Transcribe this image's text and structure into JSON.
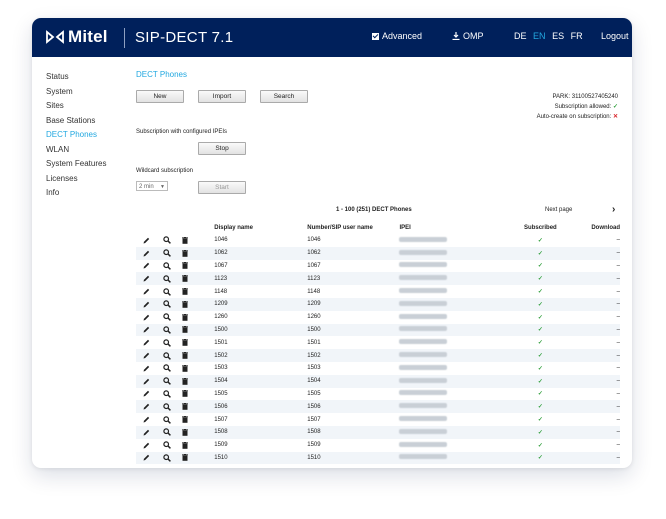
{
  "header": {
    "logo_text": "Mitel",
    "app_title": "SIP-DECT 7.1",
    "advanced_label": "Advanced",
    "omp_label": "OMP",
    "languages": [
      {
        "code": "DE",
        "active": false
      },
      {
        "code": "EN",
        "active": true
      },
      {
        "code": "ES",
        "active": false
      },
      {
        "code": "FR",
        "active": false
      }
    ],
    "logout_label": "Logout"
  },
  "sidebar": {
    "items": [
      {
        "label": "Status",
        "active": false
      },
      {
        "label": "System",
        "active": false
      },
      {
        "label": "Sites",
        "active": false
      },
      {
        "label": "Base Stations",
        "active": false
      },
      {
        "label": "DECT Phones",
        "active": true
      },
      {
        "label": "WLAN",
        "active": false
      },
      {
        "label": "System Features",
        "active": false
      },
      {
        "label": "Licenses",
        "active": false
      },
      {
        "label": "Info",
        "active": false
      }
    ]
  },
  "main": {
    "page_title": "DECT Phones",
    "new_label": "New",
    "import_label": "Import",
    "search_label": "Search",
    "park": "PARK: 31100527405240",
    "subscription_allowed": "Subscription allowed:",
    "auto_create": "Auto-create on subscription:",
    "subscription_ipei_label": "Subscription with configured IPEIs",
    "stop_label": "Stop",
    "wildcard_label": "Wildcard subscription",
    "wildcard_value": "2 min",
    "start_label": "Start",
    "pager_text": "1 - 100 (251) DECT Phones",
    "next_page_label": "Next page"
  },
  "table": {
    "columns": {
      "display_name": "Display name",
      "number": "Number/SIP user name",
      "ipei": "IPEI",
      "subscribed": "Subscribed",
      "download": "Download"
    },
    "rows": [
      {
        "name": "1046",
        "number": "1046",
        "download": "–"
      },
      {
        "name": "1062",
        "number": "1062",
        "download": "–"
      },
      {
        "name": "1067",
        "number": "1067",
        "download": "–"
      },
      {
        "name": "1123",
        "number": "1123",
        "download": "–"
      },
      {
        "name": "1148",
        "number": "1148",
        "download": "–"
      },
      {
        "name": "1209",
        "number": "1209",
        "download": "–"
      },
      {
        "name": "1260",
        "number": "1260",
        "download": "–"
      },
      {
        "name": "1500",
        "number": "1500",
        "download": "–"
      },
      {
        "name": "1501",
        "number": "1501",
        "download": "–"
      },
      {
        "name": "1502",
        "number": "1502",
        "download": "–"
      },
      {
        "name": "1503",
        "number": "1503",
        "download": "–"
      },
      {
        "name": "1504",
        "number": "1504",
        "download": "–"
      },
      {
        "name": "1505",
        "number": "1505",
        "download": "–"
      },
      {
        "name": "1506",
        "number": "1506",
        "download": "–"
      },
      {
        "name": "1507",
        "number": "1507",
        "download": "–"
      },
      {
        "name": "1508",
        "number": "1508",
        "download": "–"
      },
      {
        "name": "1509",
        "number": "1509",
        "download": "–"
      },
      {
        "name": "1510",
        "number": "1510",
        "download": "–"
      }
    ]
  },
  "colors": {
    "header_bg": "#00205b",
    "accent": "#22a8e0",
    "ok_green": "#2e9e3a",
    "error_red": "#d8262c"
  },
  "icons": {
    "edit": "pencil-icon",
    "view": "magnifier-icon",
    "delete": "trash-icon",
    "next": "chevron-right-icon",
    "ok": "check-icon",
    "error": "cross-icon"
  }
}
